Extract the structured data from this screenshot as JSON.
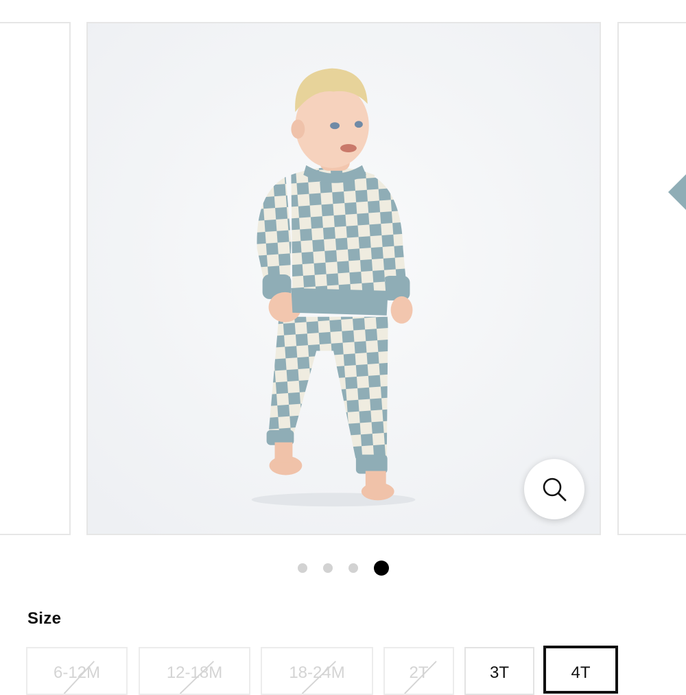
{
  "gallery": {
    "main_image_alt": "Toddler in blue and cream checkered sweatshirt and jogger set",
    "zoom_icon": "search-icon",
    "outfit_color": "#8fadb6",
    "dots": [
      {
        "active": false
      },
      {
        "active": false
      },
      {
        "active": false
      },
      {
        "active": true
      }
    ]
  },
  "size_selector": {
    "label": "Size",
    "options": [
      {
        "label": "6-12M",
        "available": false,
        "selected": false
      },
      {
        "label": "12-18M",
        "available": false,
        "selected": false
      },
      {
        "label": "18-24M",
        "available": false,
        "selected": false
      },
      {
        "label": "2T",
        "available": false,
        "selected": false
      },
      {
        "label": "3T",
        "available": true,
        "selected": false
      },
      {
        "label": "4T",
        "available": true,
        "selected": true
      }
    ]
  }
}
